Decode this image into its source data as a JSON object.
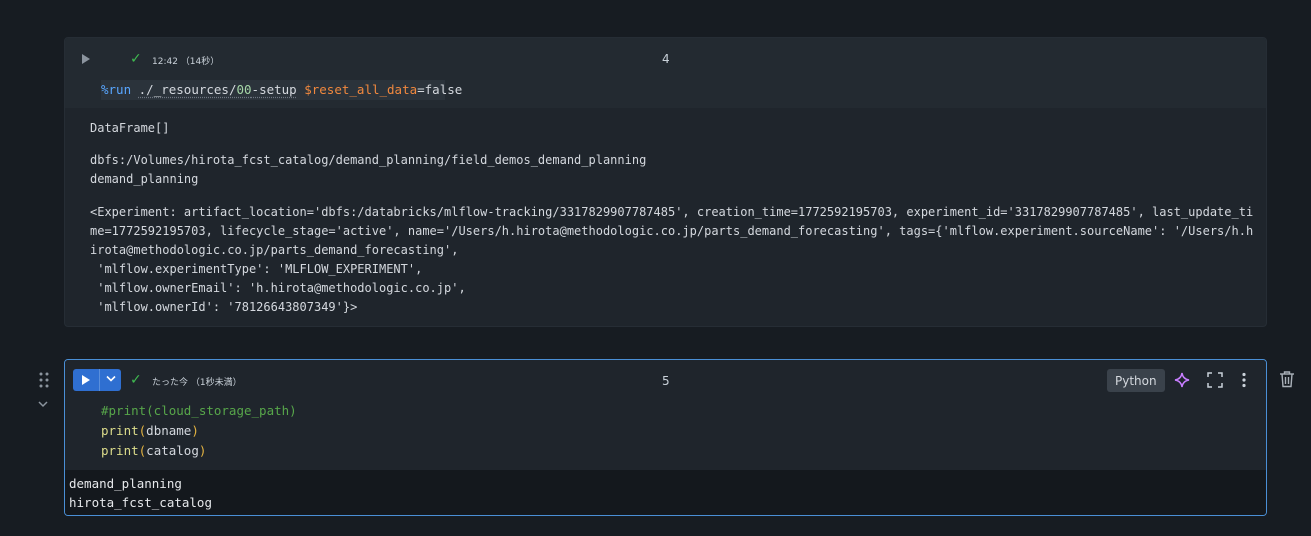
{
  "cell4": {
    "status_time": "12:42 （14秒）",
    "cell_number": "4",
    "code": {
      "magic": "%run",
      "path_a": "./_resources/",
      "path_num": "00",
      "path_b": "-setup",
      "var": "$reset_all_data",
      "rest": "=false"
    },
    "output": [
      "DataFrame[]",
      "dbfs:/Volumes/hirota_fcst_catalog/demand_planning/field_demos_demand_planning",
      "demand_planning",
      "<Experiment: artifact_location='dbfs:/databricks/mlflow-tracking/3317829907787485', creation_time=1772592195703, experiment_id='3317829907787485', last_update_ti",
      "me=1772592195703, lifecycle_stage='active', name='/Users/h.hirota@methodologic.co.jp/parts_demand_forecasting', tags={'mlflow.experiment.sourceName': '/Users/h.h",
      "irota@methodologic.co.jp/parts_demand_forecasting',",
      " 'mlflow.experimentType': 'MLFLOW_EXPERIMENT',",
      " 'mlflow.ownerEmail': 'h.hirota@methodologic.co.jp',",
      " 'mlflow.ownerId': '78126643807349'}>"
    ]
  },
  "cell5": {
    "status_time": "たった今 （1秒未満）",
    "cell_number": "5",
    "language": "Python",
    "code": {
      "comment": "#print(cloud_storage_path)",
      "fn1": "print",
      "arg1": "dbname",
      "fn2": "print",
      "arg2": "catalog"
    },
    "output": [
      "demand_planning",
      "hirota_fcst_catalog"
    ]
  }
}
